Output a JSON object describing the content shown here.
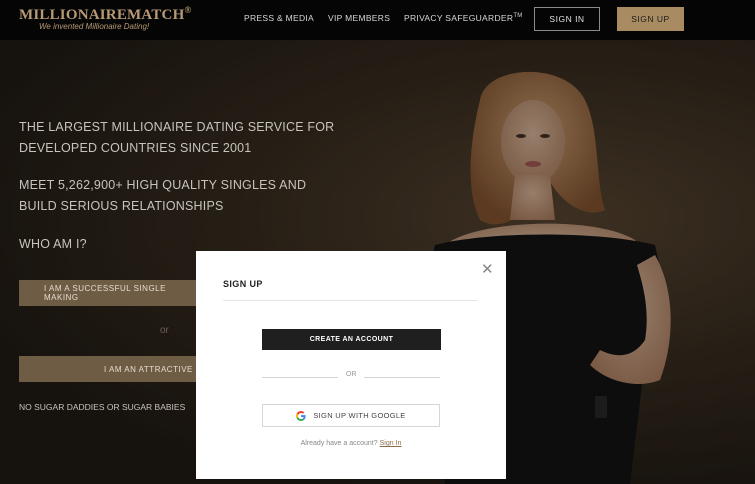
{
  "header": {
    "logo": "MILLIONAIREMATCH",
    "logo_mark": "®",
    "tagline": "We invented Millionaire Dating!",
    "nav": {
      "press": "PRESS & MEDIA",
      "vip": "VIP MEMBERS",
      "privacy": "PRIVACY SAFEGUARDER",
      "privacy_mark": "TM"
    },
    "signin_label": "SIGN IN",
    "signup_label": "SIGN UP"
  },
  "hero": {
    "line1": "THE LARGEST MILLIONAIRE DATING SERVICE FOR",
    "line2": "DEVELOPED COUNTRIES SINCE 2001",
    "line3": "MEET 5,262,900+ HIGH QUALITY SINGLES AND",
    "line4": "BUILD SERIOUS RELATIONSHIPS",
    "question": "WHO AM I?",
    "option1": "I AM A SUCCESSFUL SINGLE MAKING",
    "or_label": "or",
    "option2": "I AM AN ATTRACTIVE",
    "disclaimer": "NO SUGAR DADDIES OR SUGAR BABIES"
  },
  "modal": {
    "title": "SIGN UP",
    "close_icon": "close-icon",
    "create_label": "CREATE AN ACCOUNT",
    "or_label": "OR",
    "google_label": "SIGN UP WITH GOOGLE",
    "already_text": "Already have a account?",
    "signin_link": "Sign In"
  },
  "colors": {
    "accent": "#a98b62",
    "topbar": "#050505",
    "modal_button": "#1f1f1f"
  }
}
